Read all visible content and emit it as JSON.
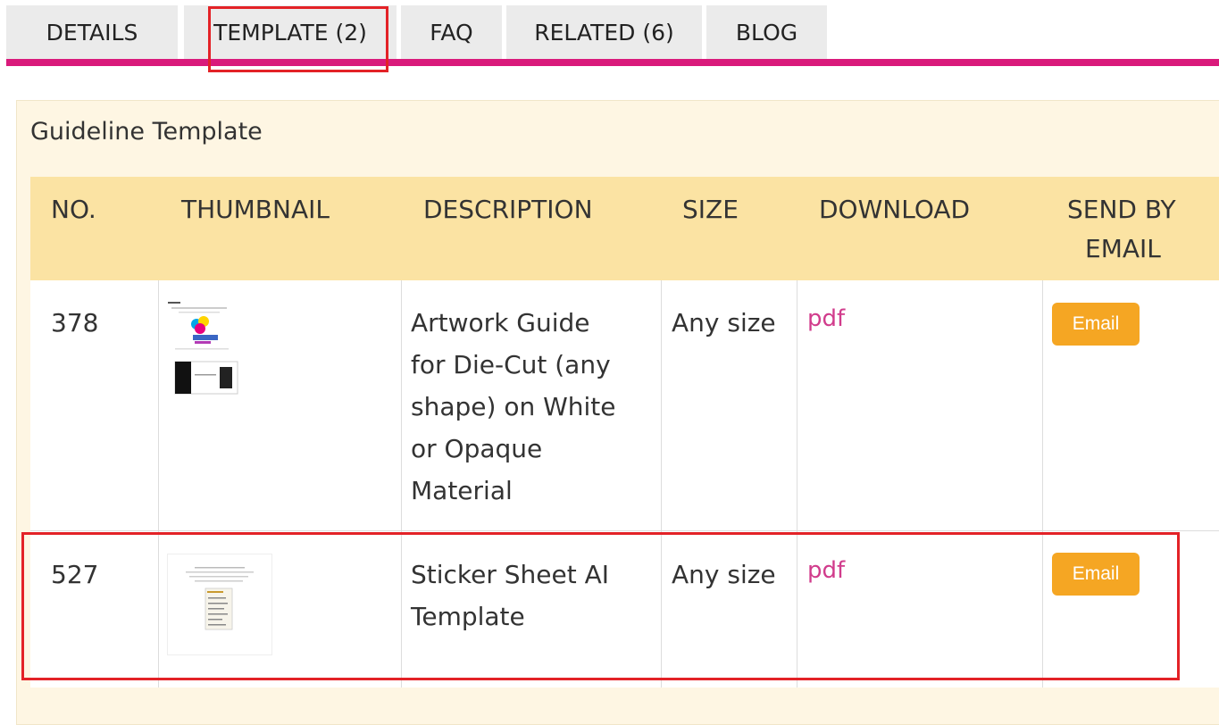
{
  "tabs": [
    {
      "label": "DETAILS"
    },
    {
      "label": "TEMPLATE (2)"
    },
    {
      "label": "FAQ"
    },
    {
      "label": "RELATED (6)"
    },
    {
      "label": "BLOG"
    }
  ],
  "active_tab": "TEMPLATE (2)",
  "section_title": "Guideline Template",
  "table": {
    "headers": {
      "no": "NO.",
      "thumbnail": "THUMBNAIL",
      "description": "DESCRIPTION",
      "size": "SIZE",
      "download": "DOWNLOAD",
      "send_by_email_1": "SEND BY",
      "send_by_email_2": "EMAIL"
    },
    "rows": [
      {
        "no": "378",
        "description_lines": [
          "Artwork Guide",
          "for Die-Cut (any",
          "shape) on White",
          "or Opaque",
          "Material"
        ],
        "size": "Any size",
        "download": "pdf",
        "email_label": "Email"
      },
      {
        "no": "527",
        "description_lines": [
          "Sticker Sheet AI",
          "Template"
        ],
        "size": "Any size",
        "download": "pdf",
        "email_label": "Email"
      }
    ]
  },
  "colors": {
    "tab_accent": "#d91a7b",
    "highlight": "#e32227",
    "header_bg": "#fbe3a3",
    "panel_bg": "#fef6e3",
    "link": "#d13c8c",
    "button": "#f5a623"
  }
}
